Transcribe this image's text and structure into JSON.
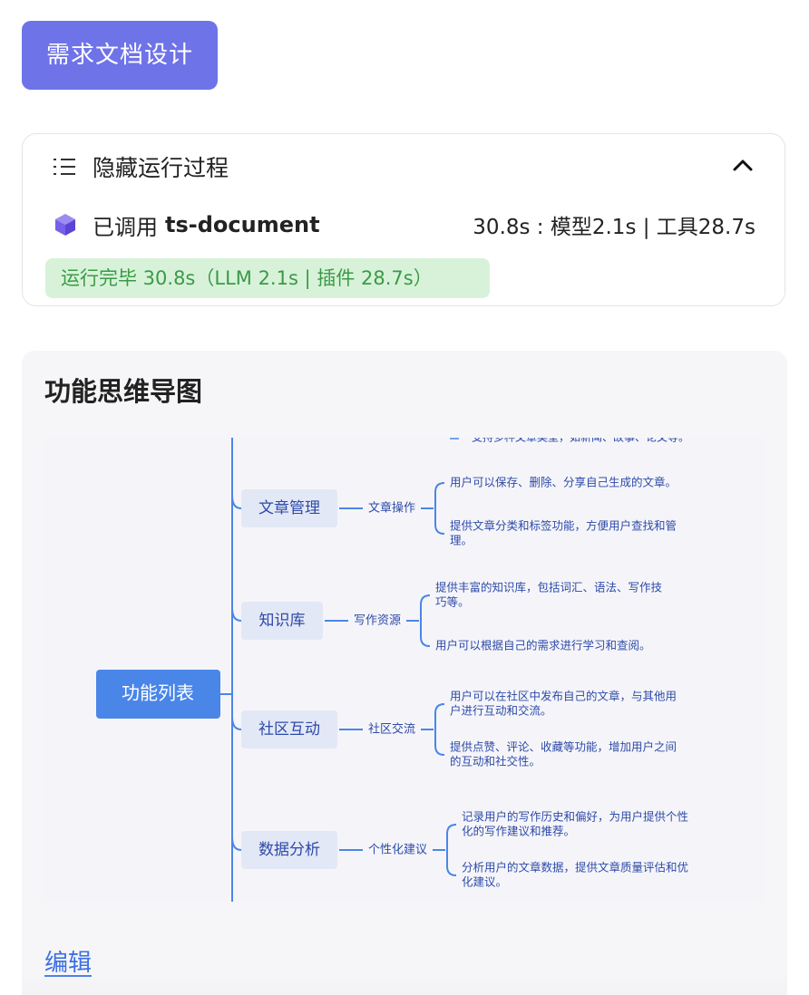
{
  "tag_button": {
    "label": "需求文档设计"
  },
  "run": {
    "toggle_label": "隐藏运行过程",
    "tool_prefix": "已调用",
    "tool_name": "ts-document",
    "tool_time": "30.8s : 模型2.1s | 工具28.7s",
    "done_badge": "运行完毕 30.8s（LLM 2.1s | 插件 28.7s）"
  },
  "panel": {
    "title": "功能思维导图",
    "edit_link": "编辑"
  },
  "mindmap": {
    "root": "功能列表",
    "cutoff_text": "支持多种文章类型，如新闻、故事、论文等。",
    "branches": [
      {
        "label": "文章管理",
        "sub": "文章操作",
        "leaves": [
          [
            "用户可以保存、删除、分享自己生成的文章。"
          ],
          [
            "提供文章分类和标签功能，方便用户查找和管",
            "理。"
          ]
        ]
      },
      {
        "label": "知识库",
        "sub": "写作资源",
        "leaves": [
          [
            "提供丰富的知识库，包括词汇、语法、写作技",
            "巧等。"
          ],
          [
            "用户可以根据自己的需求进行学习和查阅。"
          ]
        ]
      },
      {
        "label": "社区互动",
        "sub": "社区交流",
        "leaves": [
          [
            "用户可以在社区中发布自己的文章，与其他用",
            "户进行互动和交流。"
          ],
          [
            "提供点赞、评论、收藏等功能，增加用户之间",
            "的互动和社交性。"
          ]
        ]
      },
      {
        "label": "数据分析",
        "sub": "个性化建议",
        "leaves": [
          [
            "记录用户的写作历史和偏好，为用户提供个性",
            "化的写作建议和推荐。"
          ],
          [
            "分析用户的文章数据，提供文章质量评估和优",
            "化建议。"
          ]
        ]
      }
    ],
    "colors": {
      "root_bg": "#4a86e8",
      "branch_bg": "#e3e8f6",
      "line": "#4a86e8",
      "text": "#2d4aa8"
    }
  }
}
